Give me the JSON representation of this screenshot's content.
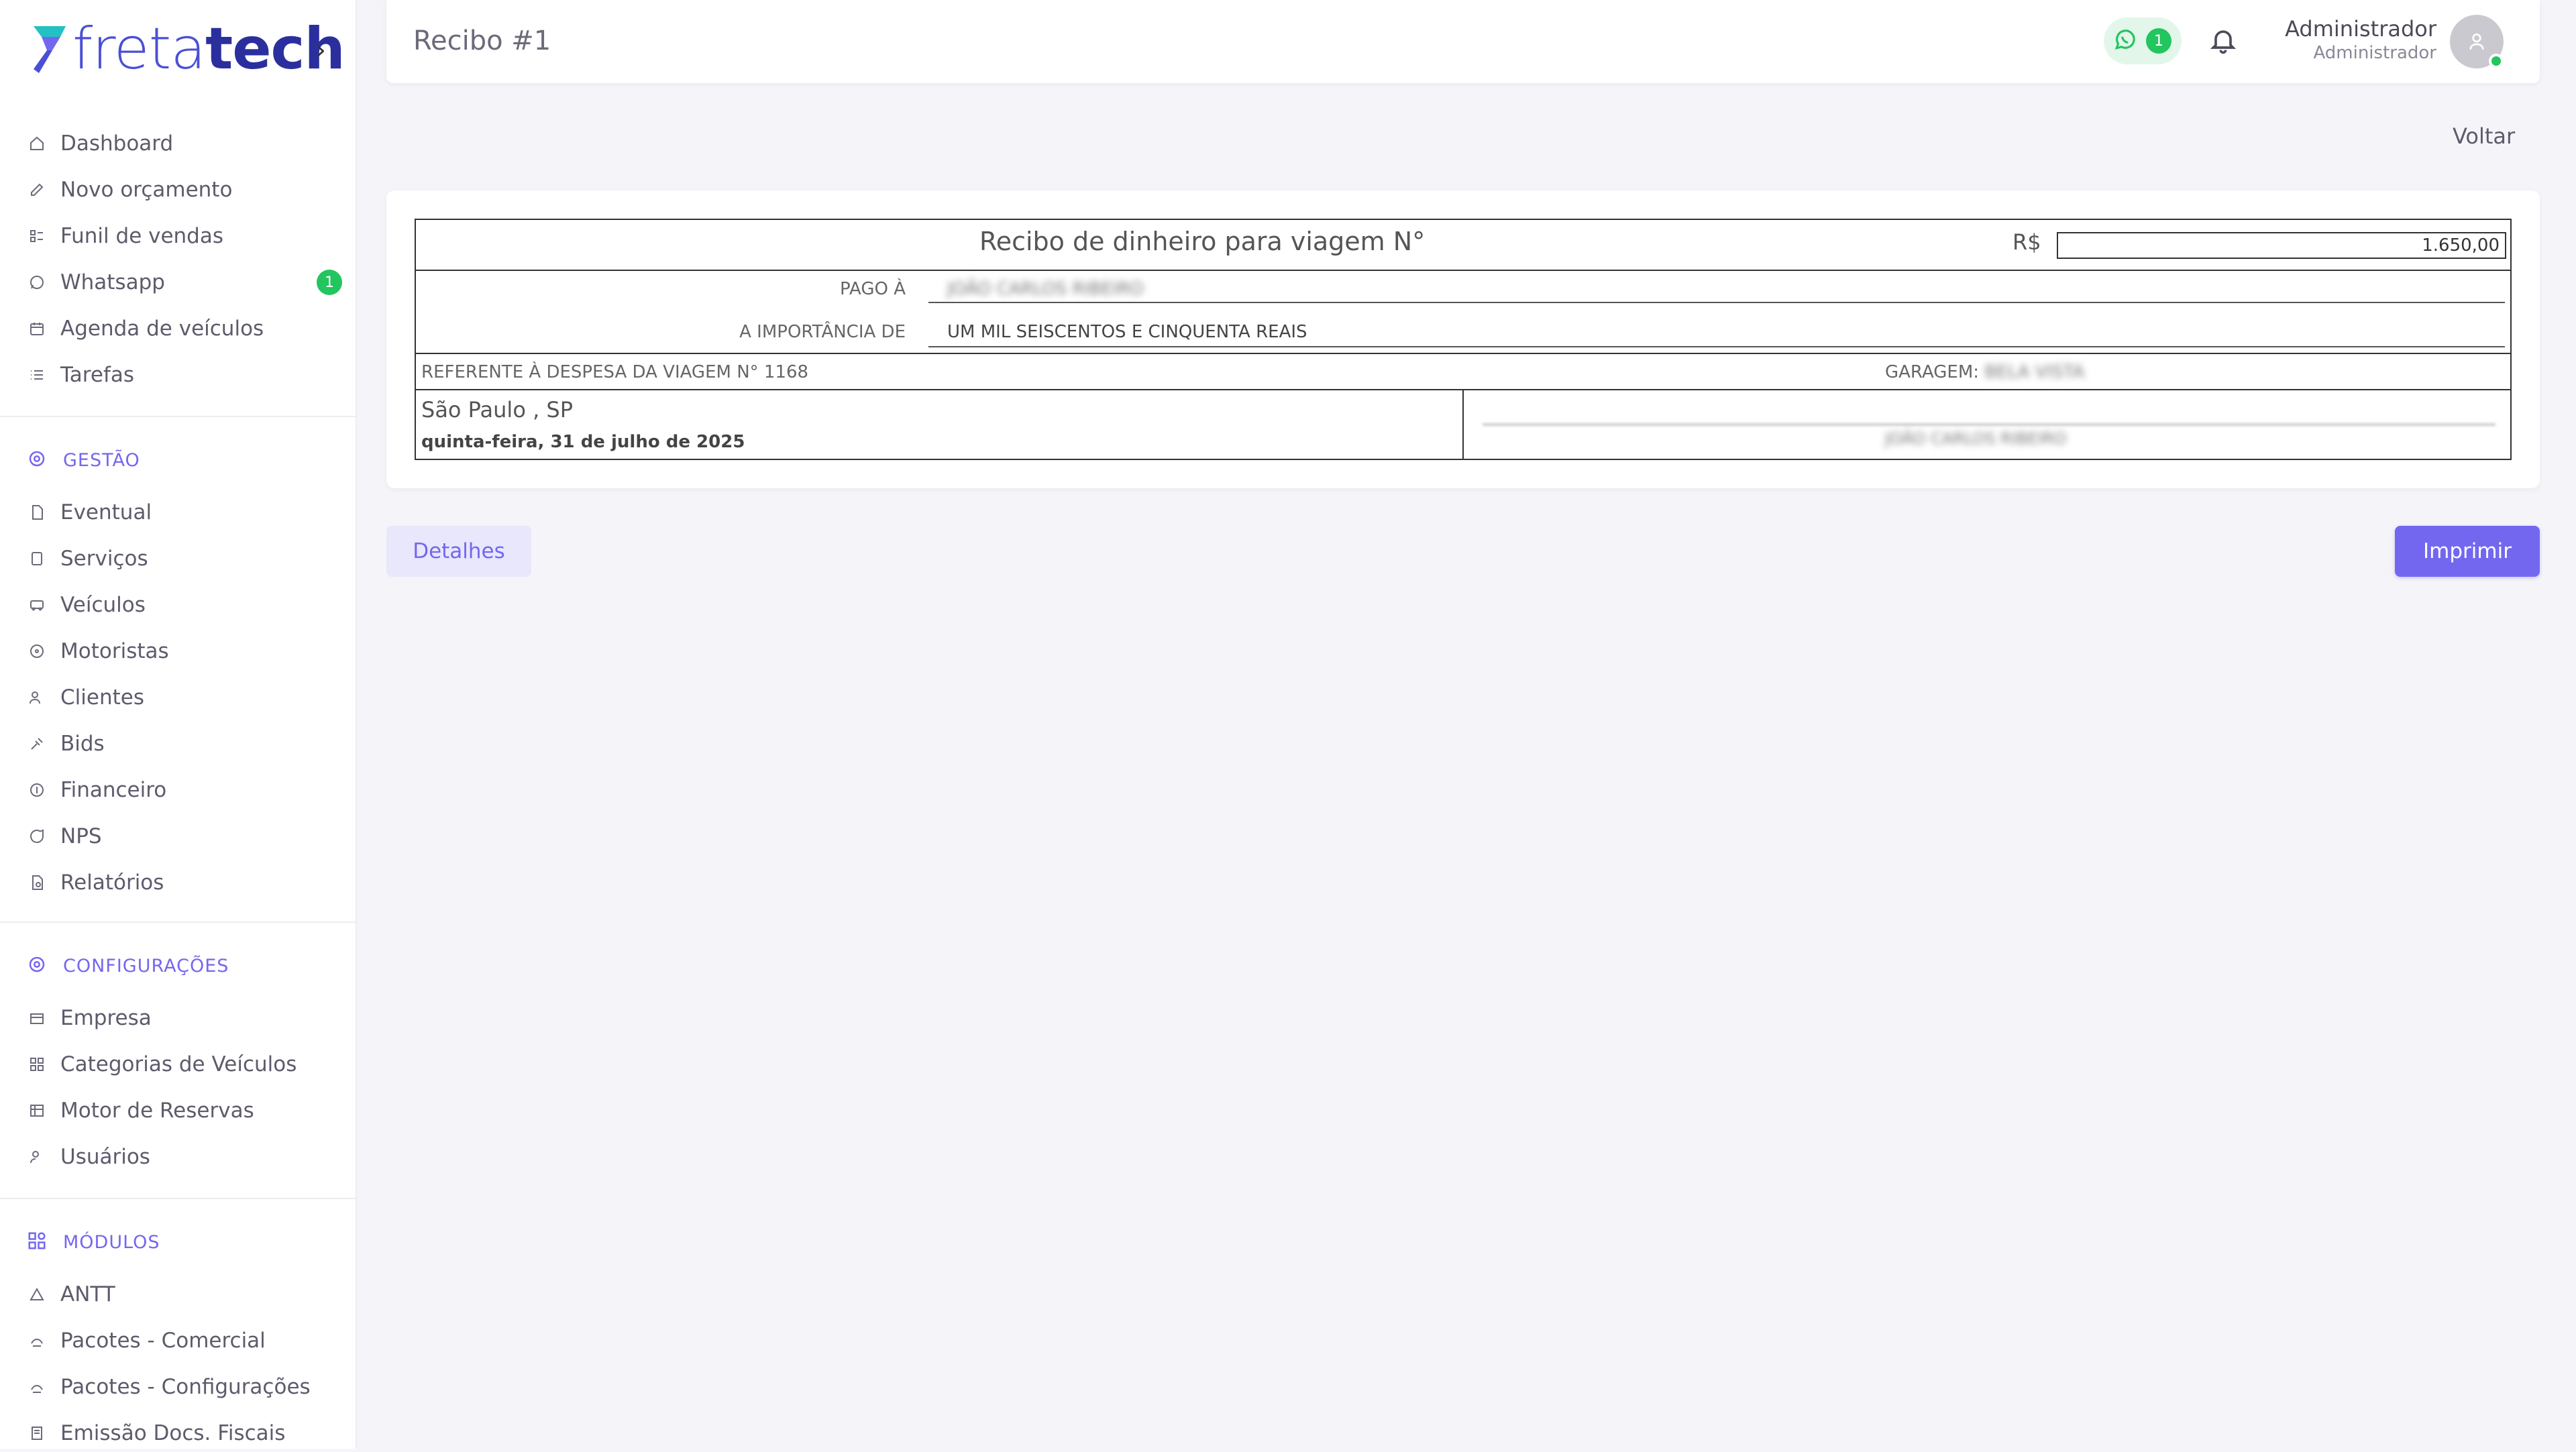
{
  "brand": {
    "part1": "freta",
    "part2": "tech",
    "toggle": "›"
  },
  "sidebar": {
    "items": [
      {
        "label": "Dashboard"
      },
      {
        "label": "Novo orçamento"
      },
      {
        "label": "Funil de vendas"
      },
      {
        "label": "Whatsapp",
        "badge": "1"
      },
      {
        "label": "Agenda de veículos"
      },
      {
        "label": "Tarefas"
      }
    ],
    "gestao": {
      "title": "GESTÃO",
      "items": [
        {
          "label": "Eventual"
        },
        {
          "label": "Serviços"
        },
        {
          "label": "Veículos"
        },
        {
          "label": "Motoristas"
        },
        {
          "label": "Clientes"
        },
        {
          "label": "Bids"
        },
        {
          "label": "Financeiro"
        },
        {
          "label": "NPS"
        },
        {
          "label": "Relatórios"
        }
      ]
    },
    "config": {
      "title": "CONFIGURAÇÕES",
      "items": [
        {
          "label": "Empresa"
        },
        {
          "label": "Categorias de Veículos"
        },
        {
          "label": "Motor de Reservas"
        },
        {
          "label": "Usuários"
        }
      ]
    },
    "modulos": {
      "title": "MÓDULOS",
      "items": [
        {
          "label": "ANTT"
        },
        {
          "label": "Pacotes - Comercial"
        },
        {
          "label": "Pacotes - Configurações"
        },
        {
          "label": "Emissão Docs. Fiscais"
        }
      ]
    }
  },
  "header": {
    "title": "Recibo #1",
    "whatsapp_count": "1",
    "user_name": "Administrador",
    "user_role": "Administrador"
  },
  "back_label": "Voltar",
  "receipt": {
    "title": "Recibo de dinheiro para viagem N°",
    "currency": "R$",
    "amount": "1.650,00",
    "paid_to_label": "PAGO À",
    "paid_to_value": "JOÃO CARLOS RIBEIRO",
    "amount_words_label": "A IMPORTÂNCIA DE",
    "amount_words": "UM MIL SEISCENTOS E CINQUENTA REAIS",
    "reference": "REFERENTE À DESPESA DA VIAGEM N° 1168",
    "garage_label": "GARAGEM:",
    "garage_value": "BELA VISTA",
    "city": "São Paulo , SP",
    "date": "quinta-feira, 31 de julho de 2025",
    "signature_name": "JOÃO CARLOS RIBEIRO"
  },
  "actions": {
    "details": "Detalhes",
    "print": "Imprimir"
  },
  "colors": {
    "accent": "#7367f0",
    "success": "#22c55e",
    "brand_dark": "#2b2f9e"
  }
}
